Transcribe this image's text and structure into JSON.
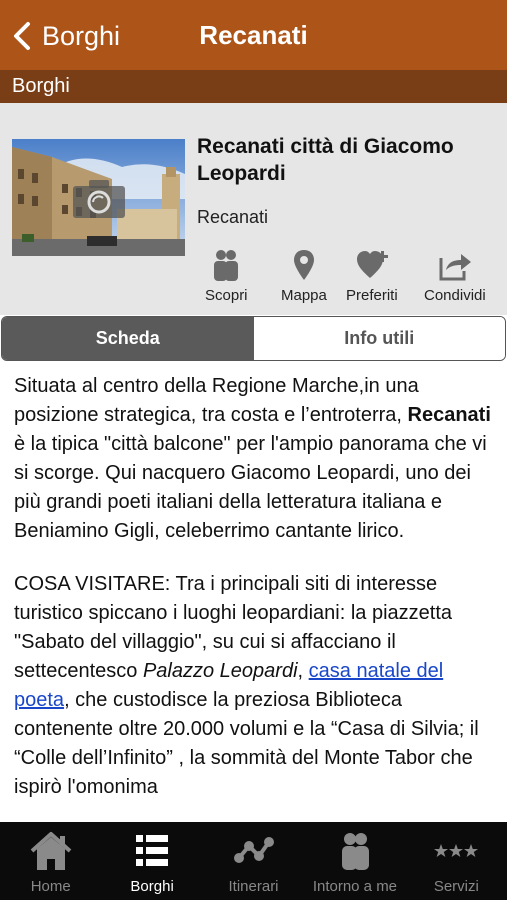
{
  "nav": {
    "back_label": "Borghi",
    "title": "Recanati"
  },
  "section": {
    "label": "Borghi"
  },
  "place": {
    "title": "Recanati città di Giacomo Leopardi",
    "subtitle": "Recanati"
  },
  "actions": [
    {
      "label": "Scopri",
      "icon": "people-icon"
    },
    {
      "label": "Mappa",
      "icon": "map-pin-icon"
    },
    {
      "label": "Preferiti",
      "icon": "heart-plus-icon"
    },
    {
      "label": "Condividi",
      "icon": "share-icon"
    }
  ],
  "segments": [
    {
      "label": "Scheda",
      "active": true
    },
    {
      "label": "Info utili",
      "active": false
    }
  ],
  "content": {
    "p1_before": "Situata al centro della Regione Marche,in una posizione strategica, tra costa e l’entroterra, ",
    "p1_bold": "Recanati",
    "p1_after": " è la tipica \"città balcone\" per l'ampio panorama che vi si scorge. Qui nacquero Giacomo Leopardi, uno dei più grandi poeti italiani della letteratura italiana e Beniamino Gigli, celeberrimo cantante lirico.",
    "p2_before": "COSA VISITARE: Tra i principali siti di interesse turistico spiccano i luoghi leopardiani: la piazzetta \"Sabato del villaggio\", su cui si affacciano il settecentesco ",
    "p2_italic": "Palazzo Leopardi",
    "p2_comma": ", ",
    "p2_link": "casa natale del poeta",
    "p2_after": ", che custodisce la preziosa Biblioteca contenente oltre 20.000 volumi e la “Casa di Silvia; il “Colle dell’Infinito” , la sommità del Monte Tabor che ispirò l'omonima"
  },
  "tabs": [
    {
      "label": "Home",
      "icon": "home-icon",
      "active": false
    },
    {
      "label": "Borghi",
      "icon": "list-icon",
      "active": true
    },
    {
      "label": "Itinerari",
      "icon": "route-icon",
      "active": false
    },
    {
      "label": "Intorno a me",
      "icon": "people-icon",
      "active": false
    },
    {
      "label": "Servizi",
      "icon": "stars-icon",
      "active": false
    }
  ],
  "colors": {
    "navbar": "#ad5418",
    "section_bar": "#7a3e16",
    "link": "#1a47c9"
  }
}
